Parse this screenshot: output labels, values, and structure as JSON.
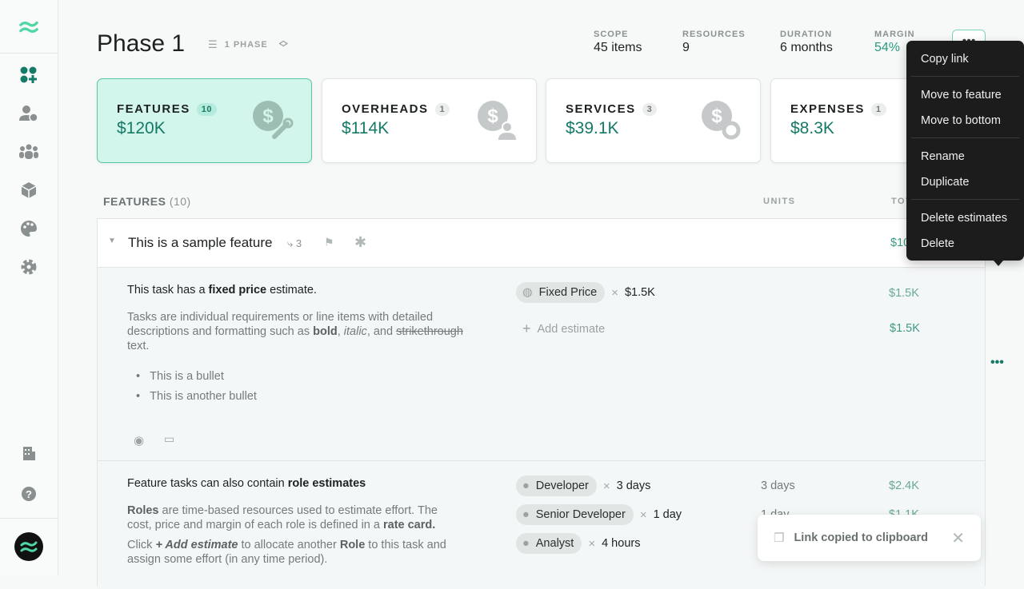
{
  "sidebar": {
    "items": [
      "estimates",
      "rate-cards",
      "team",
      "products",
      "themes",
      "settings"
    ],
    "bottom": [
      "company",
      "help"
    ]
  },
  "header": {
    "title": "Phase 1",
    "phase_selector": "1 PHASE",
    "stats": [
      {
        "label": "SCOPE",
        "value": "45 items"
      },
      {
        "label": "RESOURCES",
        "value": "9"
      },
      {
        "label": "DURATION",
        "value": "6 months"
      },
      {
        "label": "MARGIN",
        "value": "54%"
      }
    ],
    "more_label": "•••"
  },
  "cards": [
    {
      "title": "FEATURES",
      "count": "10",
      "value": "$120K"
    },
    {
      "title": "OVERHEADS",
      "count": "1",
      "value": "$114K"
    },
    {
      "title": "SERVICES",
      "count": "3",
      "value": "$39.1K"
    },
    {
      "title": "EXPENSES",
      "count": "1",
      "value": "$8.3K"
    }
  ],
  "section": {
    "title": "FEATURES",
    "count": "(10)",
    "col_units": "UNITS",
    "col_total": "TOTAL"
  },
  "feature": {
    "name": "This is a sample feature",
    "task_count": "3",
    "total": "$10.7K"
  },
  "task1": {
    "heading_pre": "This task has a ",
    "heading_bold": "fixed price",
    "heading_post": " estimate.",
    "p1": "Tasks are individual requirements or line items with detailed descriptions and formatting such as ",
    "bold": "bold",
    "comma": ", ",
    "italic": "italic",
    "and": ", and ",
    "strike": "strikethrough",
    "end": " text.",
    "bullets": [
      "This is a bullet",
      "This is another bullet"
    ],
    "estimate_chip": "Fixed Price",
    "estimate_value": "$1.5K",
    "estimate_total": "$1.5K",
    "add_estimate": "Add estimate",
    "task_total": "$1.5K"
  },
  "task2": {
    "heading_pre": "Feature tasks can also contain ",
    "heading_bold": "role estimates",
    "p1_bold": "Roles",
    "p1": " are time-based resources used to estimate effort. The cost, price and margin of each role is defined in a ",
    "p1_bold2": "rate card.",
    "p2_pre": "Click ",
    "p2_bi": "+ Add estimate",
    "p2_mid": " to allocate another ",
    "p2_bold": "Role",
    "p2_post": " to this task and assign some effort (in any time period).",
    "roles": [
      {
        "name": "Developer",
        "value": "3 days",
        "units": "3 days",
        "total": "$2.4K"
      },
      {
        "name": "Senior Developer",
        "value": "1 day",
        "units": "1 day",
        "total": "$1.1K"
      },
      {
        "name": "Analyst",
        "value": "4 hours",
        "units": "",
        "total": ""
      }
    ]
  },
  "menu": {
    "items": [
      "Copy link",
      "Move to feature",
      "Move to bottom",
      "Rename",
      "Duplicate",
      "Delete estimates",
      "Delete"
    ]
  },
  "toast": {
    "message": "Link copied to clipboard"
  },
  "colors": {
    "accent": "#157a66",
    "active_card": "#d2f5ec",
    "menu_bg": "#1c1c1c"
  }
}
